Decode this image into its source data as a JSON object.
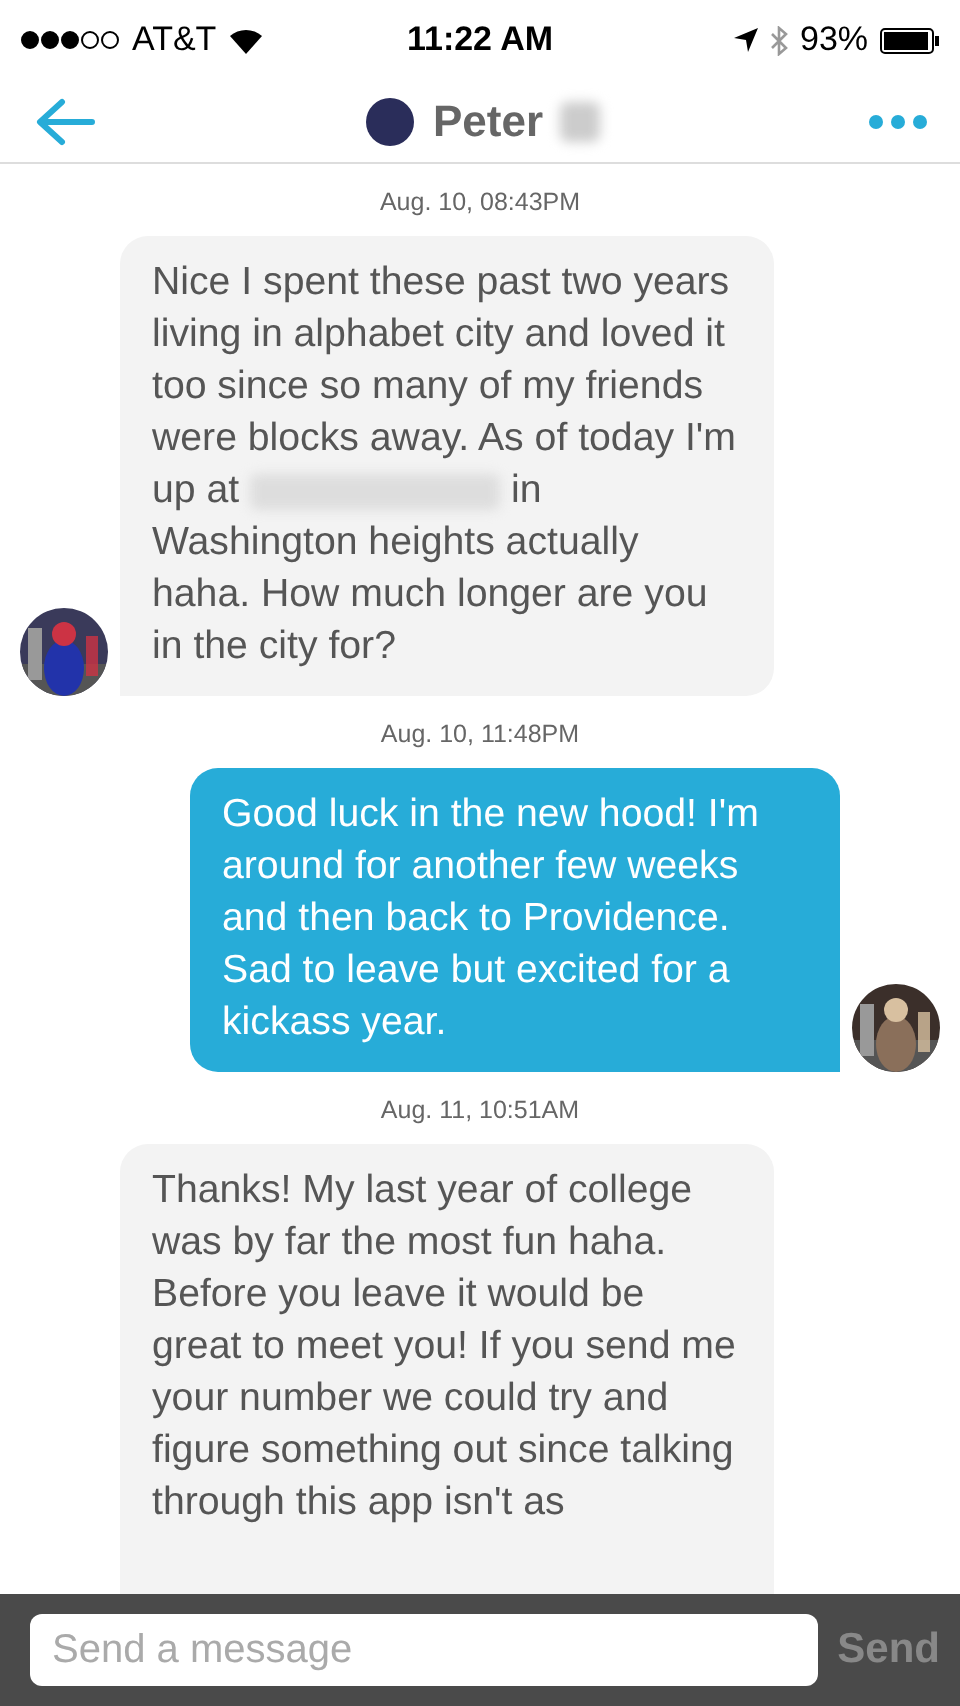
{
  "status_bar": {
    "carrier": "AT&T",
    "time": "11:22 AM",
    "battery": "93%"
  },
  "header": {
    "name": "Peter",
    "name_redacted": true
  },
  "messages": [
    {
      "kind": "incoming",
      "timestamp": "Aug. 10, 08:43PM",
      "parts": [
        "Nice I spent these past two years living in alphabet city and loved it too since so many of my friends were blocks away. As of today I'm up at",
        "in Washington heights actually haha. How much longer are you in the city for?"
      ],
      "avatar": true
    },
    {
      "kind": "outgoing",
      "timestamp": "Aug. 10, 11:48PM",
      "parts": [
        "Good luck in the new hood!  I'm around for another few weeks and then back to Providence. Sad to leave but excited for a kickass year."
      ],
      "avatar": true
    },
    {
      "kind": "incoming",
      "timestamp": "Aug. 11, 10:51AM",
      "parts": [
        "Thanks! My last year of college was by far the most fun haha. Before you leave it would be great to meet you! If you send me your number we could try and figure something out since talking through this app isn't as"
      ]
    }
  ],
  "composer": {
    "placeholder": "Send a message",
    "send": "Send"
  }
}
